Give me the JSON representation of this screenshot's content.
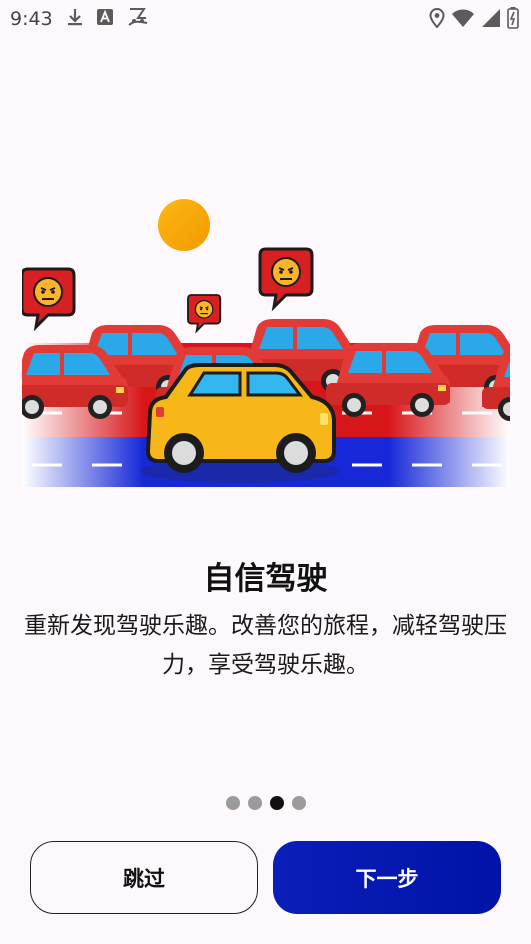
{
  "status_bar": {
    "time": "9:43",
    "left_icons": [
      "download-icon",
      "text-a-icon",
      "carrier-logo-icon"
    ],
    "right_icons": [
      "location-pin-icon",
      "wifi-icon",
      "signal-icon",
      "battery-icon"
    ]
  },
  "illustration": {
    "description_icons": [
      "sun-icon",
      "angry-emoji-icon",
      "yellow-car-icon",
      "red-car-icon",
      "road-icon"
    ],
    "colors": {
      "sun": "#f7a600",
      "red_car": "#e23a36",
      "yellow_car": "#f7b718",
      "road_blue": "#1628d8",
      "road_red": "#d7161a"
    }
  },
  "onboarding": {
    "title": "自信驾驶",
    "description": "重新发现驾驶乐趣。改善您的旅程，减轻驾驶压力，享受驾驶乐趣。",
    "page_count": 4,
    "active_page": 3
  },
  "buttons": {
    "skip_label": "跳过",
    "next_label": "下一步"
  },
  "colors": {
    "primary": "#0012a8",
    "background": "#fcf8fb"
  }
}
